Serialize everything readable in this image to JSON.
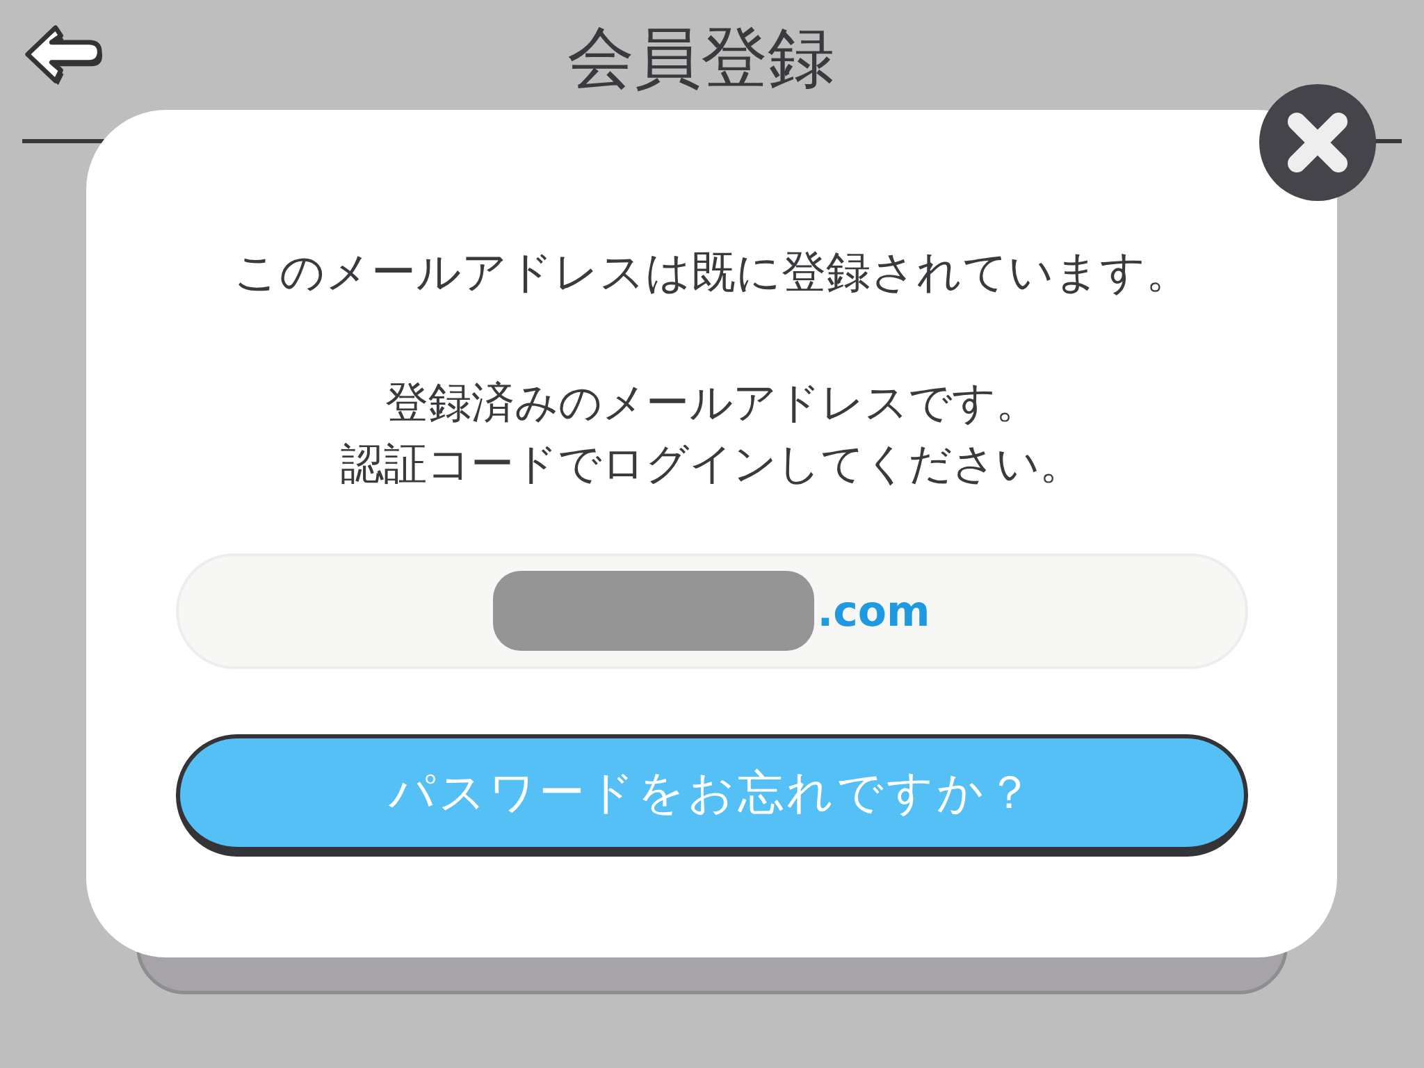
{
  "header": {
    "title": "会員登録"
  },
  "dialog": {
    "message": "このメールアドレスは既に登録されています。",
    "detail_lines": [
      "登録済みのメールアドレスです。",
      "認証コードでログインしてください。"
    ],
    "email_field": {
      "value": ".com",
      "redacted": true
    },
    "button": "パスワードをお忘れですか？"
  }
}
